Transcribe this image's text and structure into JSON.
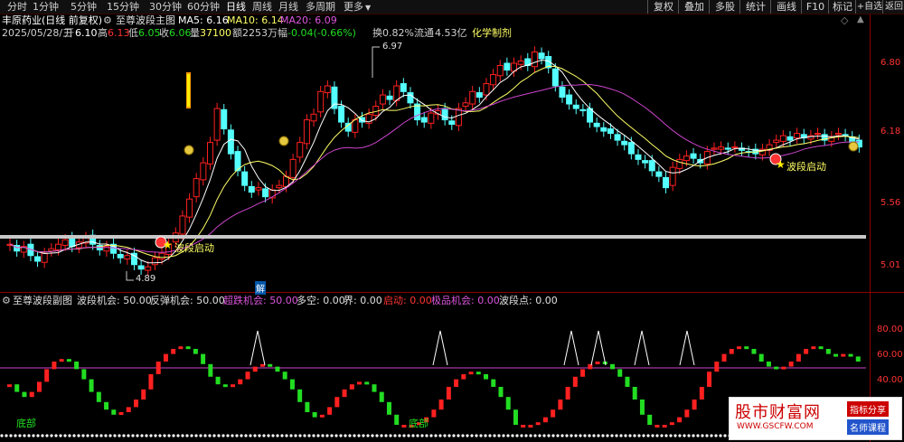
{
  "toolbar": {
    "tabs": [
      "分时",
      "1分钟",
      "5分钟",
      "15分钟",
      "30分钟",
      "60分钟",
      "日线",
      "周线",
      "月线",
      "多周期",
      "更多"
    ],
    "active_tab": "日线",
    "right_buttons": [
      "复权",
      "叠加",
      "多股",
      "统计",
      "画线",
      "F10",
      "标记",
      "+自选",
      "返回"
    ]
  },
  "header": {
    "title": "丰原药业(日线 前复权)",
    "indicator_name": "至尊波段主图",
    "ma5_label": "MA5: 6.16",
    "ma10_label": "MA10: 6.14",
    "ma20_label": "MA20: 6.09",
    "date": "2025/05/28/三",
    "open_label": "开",
    "open_value": "6.10",
    "high_label": "高",
    "high_value": "6.13",
    "low_label": "低",
    "low_value": "6.05",
    "close_label": "收",
    "close_value": "6.06",
    "volume_label": "量",
    "volume_value": "37100",
    "amount_label": "额",
    "amount_value": "2253万",
    "change_label": "幅",
    "change_value": "-0.04(-0.66%)",
    "turnover_label": "换",
    "turnover_value": "0.82%",
    "float_label": "流通",
    "float_value": "4.53亿",
    "sector": "化学制剂"
  },
  "main_chart": {
    "price_axis": [
      "6.80",
      "6.18",
      "5.56",
      "5.01"
    ],
    "high_marker": "6.97",
    "low_marker": "4.89",
    "signal_label_1": "波段启动",
    "signal_label_2": "波段启动",
    "jie_label": "解"
  },
  "sub_chart": {
    "indicator_name": "至尊波段副图",
    "wave_chance": "波段机会: 50.00",
    "rebound_chance": "反弹机会: 50.00",
    "oversold_chance": "超跌机会: 50.00",
    "long_short": "多空: 0.00",
    "boundary": "界: 0.00",
    "start": "启动: 0.00",
    "extreme_chance": "极品机会: 0.00",
    "wave_point": "波段点: 0.00",
    "axis": [
      "80.00",
      "60.00",
      "40.00"
    ],
    "bottom_label_1": "底部",
    "bottom_label_2": "底部"
  },
  "watermark": {
    "site_name": "股市财富网",
    "url": "WWW.GSCFW.COM",
    "tag1": "指标分享",
    "tag2": "名师课程"
  },
  "colors": {
    "up": "#ff2020",
    "down": "#54ffff",
    "ma5": "#ffffff",
    "ma10": "#ffff66",
    "ma20": "#cc44cc",
    "osc_up": "#ff2020",
    "osc_down": "#22dd22"
  }
}
